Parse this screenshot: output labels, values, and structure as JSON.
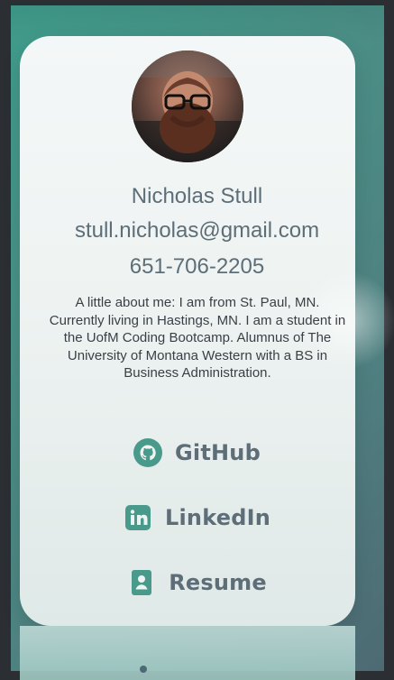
{
  "profile": {
    "name": "Nicholas Stull",
    "email": "stull.nicholas@gmail.com",
    "phone": "651-706-2205",
    "bio": "A little about me: I am from St. Paul, MN. Currently living in Hastings, MN. I am a student in the UofM Coding Bootcamp. Alumnus of The University of Montana Western with a BS in Business Administration."
  },
  "links": [
    {
      "label": "GitHub",
      "icon": "github-icon"
    },
    {
      "label": "LinkedIn",
      "icon": "linkedin-icon"
    },
    {
      "label": "Resume",
      "icon": "resume-icon"
    }
  ],
  "colors": {
    "accent": "#4a9a8b",
    "text": "#5d6e78"
  }
}
